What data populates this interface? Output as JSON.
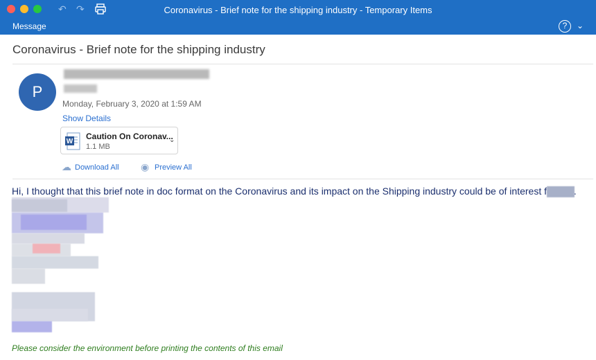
{
  "window": {
    "title": "Coronavirus - Brief note for the shipping industry - Temporary Items"
  },
  "ribbon": {
    "tab_label": "Message"
  },
  "email": {
    "subject": "Coronavirus - Brief note for the shipping industry",
    "avatar_initial": "P",
    "datetime": "Monday, February 3, 2020 at 1:59 AM",
    "show_details_label": "Show Details",
    "attachment": {
      "name": "Caution On Coronav...",
      "size": "1.1 MB"
    },
    "download_all_label": "Download All",
    "preview_all_label": "Preview All",
    "body_text": "Hi, I thought that this brief note in doc format on the Coronavirus and its impact on the Shipping industry could be of interest for you.",
    "footer_text": "Please consider the environment before printing the contents of this email"
  },
  "colors": {
    "titlebar": "#1f6fc5",
    "avatar": "#2f66b1",
    "link": "#2a6fd0",
    "body_text": "#1b2f6e",
    "footer_text": "#2e7d1e"
  },
  "icons": {
    "window_controls": [
      "close-icon",
      "minimize-icon",
      "zoom-icon"
    ],
    "toolbar": [
      "undo-icon",
      "redo-icon",
      "print-icon"
    ],
    "ribbon": [
      "help-icon",
      "chevron-down-icon"
    ],
    "attachment": "word-doc-icon",
    "actions": [
      "cloud-download-icon",
      "eye-icon"
    ]
  }
}
